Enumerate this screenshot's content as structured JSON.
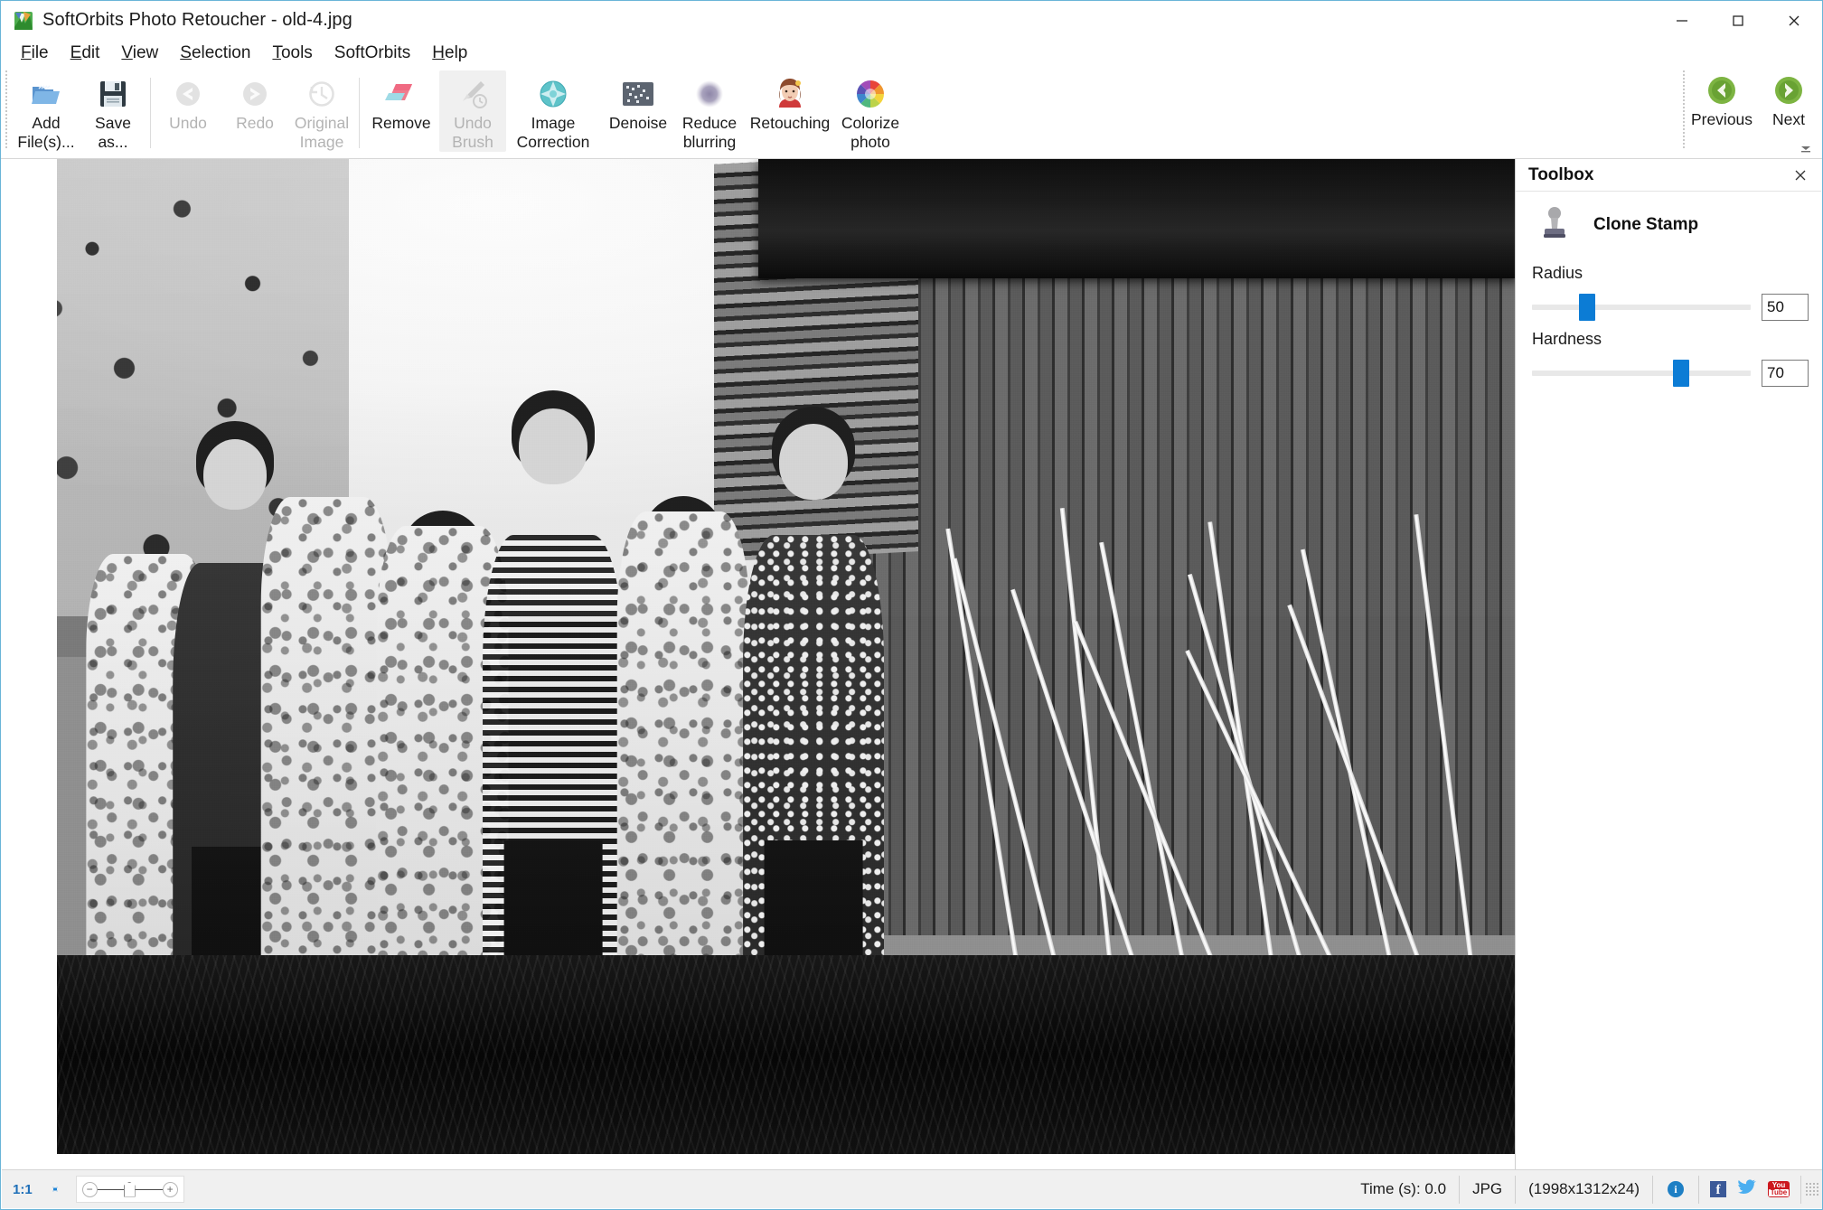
{
  "window": {
    "title": "SoftOrbits Photo Retoucher - old-4.jpg",
    "app_icon": "softorbits-logo-icon",
    "minimize_label": "Minimize",
    "maximize_label": "Maximize",
    "close_label": "Close"
  },
  "menubar": {
    "items": [
      {
        "label": "File",
        "accel": "F"
      },
      {
        "label": "Edit",
        "accel": "E"
      },
      {
        "label": "View",
        "accel": "V"
      },
      {
        "label": "Selection",
        "accel": "S"
      },
      {
        "label": "Tools",
        "accel": "T"
      },
      {
        "label": "SoftOrbits",
        "accel": ""
      },
      {
        "label": "Help",
        "accel": "H"
      }
    ]
  },
  "ribbon": {
    "buttons": [
      {
        "id": "add-files",
        "line1": "Add",
        "line2": "File(s)...",
        "icon": "open-folder-icon",
        "disabled": false
      },
      {
        "id": "save-as",
        "line1": "Save",
        "line2": "as...",
        "icon": "floppy-disk-icon",
        "disabled": false
      },
      {
        "id": "undo",
        "line1": "Undo",
        "line2": "",
        "icon": "arrow-left-circle-icon",
        "disabled": true
      },
      {
        "id": "redo",
        "line1": "Redo",
        "line2": "",
        "icon": "arrow-right-circle-icon",
        "disabled": true
      },
      {
        "id": "original-image",
        "line1": "Original",
        "line2": "Image",
        "icon": "clock-history-icon",
        "disabled": true
      },
      {
        "id": "remove",
        "line1": "Remove",
        "line2": "",
        "icon": "eraser-icon",
        "disabled": false
      },
      {
        "id": "undo-brush",
        "line1": "Undo",
        "line2": "Brush",
        "icon": "brush-history-icon",
        "disabled": true
      },
      {
        "id": "image-correction",
        "line1": "Image",
        "line2": "Correction",
        "icon": "sparkle-gem-icon",
        "disabled": false
      },
      {
        "id": "denoise",
        "line1": "Denoise",
        "line2": "",
        "icon": "noise-grid-icon",
        "disabled": false
      },
      {
        "id": "reduce-blurring",
        "line1": "Reduce",
        "line2": "blurring",
        "icon": "blur-circle-icon",
        "disabled": false
      },
      {
        "id": "retouching",
        "line1": "Retouching",
        "line2": "",
        "icon": "portrait-face-icon",
        "disabled": false
      },
      {
        "id": "colorize-photo",
        "line1": "Colorize",
        "line2": "photo",
        "icon": "color-wheel-icon",
        "disabled": false
      }
    ],
    "navigation": [
      {
        "id": "previous",
        "label": "Previous",
        "icon": "green-arrow-left-icon"
      },
      {
        "id": "next",
        "label": "Next",
        "icon": "green-arrow-right-icon"
      }
    ],
    "expand_icon": "ribbon-expand-icon"
  },
  "toolbox": {
    "panel_title": "Toolbox",
    "close_icon": "close-icon",
    "tool_icon": "clone-stamp-icon",
    "tool_name": "Clone Stamp",
    "fields": [
      {
        "id": "radius",
        "label": "Radius",
        "value": "50",
        "percent": 25
      },
      {
        "id": "hardness",
        "label": "Hardness",
        "value": "70",
        "percent": 68
      }
    ]
  },
  "statusbar": {
    "zoom_ratio": "1:1",
    "fit_icon": "fit-to-window-icon",
    "zoom_out_glyph": "−",
    "zoom_in_glyph": "+",
    "time": "Time (s): 0.0",
    "format": "JPG",
    "dimensions": "(1998x1312x24)",
    "icons": [
      {
        "id": "info",
        "name": "info-icon",
        "glyph": "i"
      },
      {
        "id": "facebook",
        "name": "facebook-icon",
        "glyph": "f"
      },
      {
        "id": "twitter",
        "name": "twitter-icon",
        "glyph": ""
      },
      {
        "id": "youtube",
        "name": "youtube-icon",
        "line1": "You",
        "line2": "Tube"
      }
    ]
  },
  "canvas": {
    "image_name": "old-4.jpg",
    "description": "Vintage black and white group photograph of seven people standing in front of a wooden shed"
  },
  "colors": {
    "accent": "#0c7cd5",
    "window_border": "#69b5d8",
    "status_bg": "#f0f0f0",
    "nav_green": "#6aa82c"
  }
}
